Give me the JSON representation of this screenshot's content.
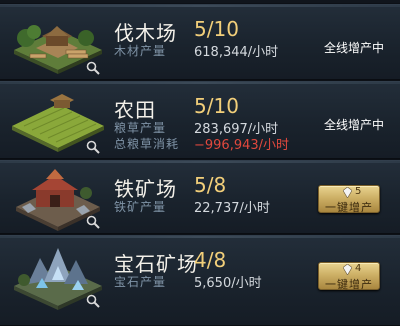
{
  "buildings": [
    {
      "name": "伐木场",
      "level": "5/10",
      "icon": "lumber-mill-icon",
      "stats": [
        {
          "label": "木材产量",
          "value": "618,344/小时",
          "negative": false
        }
      ],
      "status": "全线增产中",
      "action": null
    },
    {
      "name": "农田",
      "level": "5/10",
      "icon": "farm-icon",
      "stats": [
        {
          "label": "粮草产量",
          "value": "283,697/小时",
          "negative": false
        },
        {
          "label": "总粮草消耗",
          "value": "−996,943/小时",
          "negative": true
        }
      ],
      "status": "全线增产中",
      "action": null
    },
    {
      "name": "铁矿场",
      "level": "5/8",
      "icon": "iron-mine-icon",
      "stats": [
        {
          "label": "铁矿产量",
          "value": "22,737/小时",
          "negative": false
        }
      ],
      "status": null,
      "action": {
        "label": "一键增产",
        "cost": "5"
      }
    },
    {
      "name": "宝石矿场",
      "level": "4/8",
      "icon": "gem-mine-icon",
      "stats": [
        {
          "label": "宝石产量",
          "value": "5,650/小时",
          "negative": false
        }
      ],
      "status": null,
      "action": {
        "label": "一键增产",
        "cost": "4"
      }
    }
  ],
  "colors": {
    "level": "#f2cf7a",
    "label": "#7f93a6",
    "negative": "#e0483d",
    "button": "#cdb066"
  }
}
